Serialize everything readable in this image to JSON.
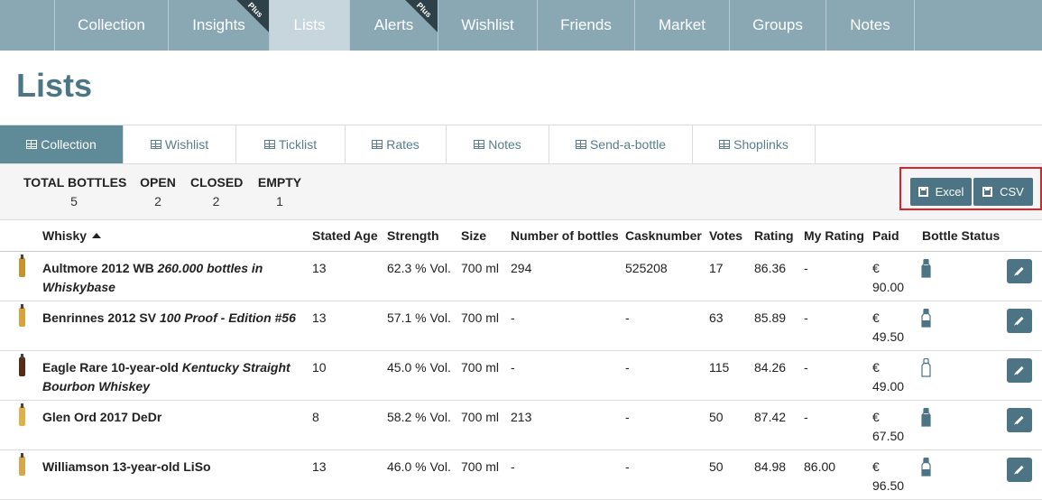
{
  "topnav": {
    "tabs": [
      {
        "label": "Collection",
        "active": false,
        "badge": ""
      },
      {
        "label": "Insights",
        "active": false,
        "badge": "Plus"
      },
      {
        "label": "Lists",
        "active": true,
        "badge": ""
      },
      {
        "label": "Alerts",
        "active": false,
        "badge": "Plus"
      },
      {
        "label": "Wishlist",
        "active": false,
        "badge": ""
      },
      {
        "label": "Friends",
        "active": false,
        "badge": ""
      },
      {
        "label": "Market",
        "active": false,
        "badge": ""
      },
      {
        "label": "Groups",
        "active": false,
        "badge": ""
      },
      {
        "label": "Notes",
        "active": false,
        "badge": ""
      }
    ]
  },
  "page": {
    "title": "Lists"
  },
  "subtabs": [
    {
      "label": "Collection",
      "active": true
    },
    {
      "label": "Wishlist",
      "active": false
    },
    {
      "label": "Ticklist",
      "active": false
    },
    {
      "label": "Rates",
      "active": false
    },
    {
      "label": "Notes",
      "active": false
    },
    {
      "label": "Send-a-bottle",
      "active": false
    },
    {
      "label": "Shoplinks",
      "active": false
    }
  ],
  "summary": {
    "total_label": "TOTAL BOTTLES",
    "total": "5",
    "open_label": "OPEN",
    "open": "2",
    "closed_label": "CLOSED",
    "closed": "2",
    "empty_label": "EMPTY",
    "empty": "1"
  },
  "export": {
    "excel_label": "Excel",
    "csv_label": "CSV"
  },
  "table": {
    "headers": {
      "whisky": "Whisky",
      "age": "Stated Age",
      "strength": "Strength",
      "size": "Size",
      "bottles": "Number of bottles",
      "cask": "Casknumber",
      "votes": "Votes",
      "rating": "Rating",
      "my_rating": "My Rating",
      "paid": "Paid",
      "status": "Bottle Status"
    },
    "rows": [
      {
        "name": "Aultmore 2012 WB",
        "name_italic": "260.000 bottles in Whiskybase",
        "age": "13",
        "strength": "62.3 % Vol.",
        "size": "700 ml",
        "bottles": "294",
        "cask": "525208",
        "votes": "17",
        "rating": "86.36",
        "my_rating": "-",
        "currency": "€",
        "paid": "90.00",
        "status": "full",
        "thumb_color": "#c8922e"
      },
      {
        "name": "Benrinnes 2012 SV",
        "name_italic": "100 Proof - Edition #56",
        "age": "13",
        "strength": "57.1 % Vol.",
        "size": "700 ml",
        "bottles": "-",
        "cask": "-",
        "votes": "63",
        "rating": "85.89",
        "my_rating": "-",
        "currency": "€",
        "paid": "49.50",
        "status": "open",
        "thumb_color": "#d9a23c"
      },
      {
        "name": "Eagle Rare 10-year-old",
        "name_italic": "Kentucky Straight Bourbon Whiskey",
        "age": "10",
        "strength": "45.0 % Vol.",
        "size": "700 ml",
        "bottles": "-",
        "cask": "-",
        "votes": "115",
        "rating": "84.26",
        "my_rating": "-",
        "currency": "€",
        "paid": "49.00",
        "status": "empty",
        "thumb_color": "#5a2a14"
      },
      {
        "name": "Glen Ord 2017 DeDr",
        "name_italic": "",
        "age": "8",
        "strength": "58.2 % Vol.",
        "size": "700 ml",
        "bottles": "213",
        "cask": "-",
        "votes": "50",
        "rating": "87.42",
        "my_rating": "-",
        "currency": "€",
        "paid": "67.50",
        "status": "full",
        "thumb_color": "#e0b04a"
      },
      {
        "name": "Williamson 13-year-old LiSo",
        "name_italic": "",
        "age": "13",
        "strength": "46.0 % Vol.",
        "size": "700 ml",
        "bottles": "-",
        "cask": "-",
        "votes": "50",
        "rating": "84.98",
        "my_rating": "86.00",
        "currency": "€",
        "paid": "96.50",
        "status": "open",
        "thumb_color": "#d8a848"
      }
    ]
  },
  "colors": {
    "accent": "#4d7484",
    "nav": "#8aa8b4",
    "title": "#4c7586",
    "highlight": "#d9252a"
  }
}
